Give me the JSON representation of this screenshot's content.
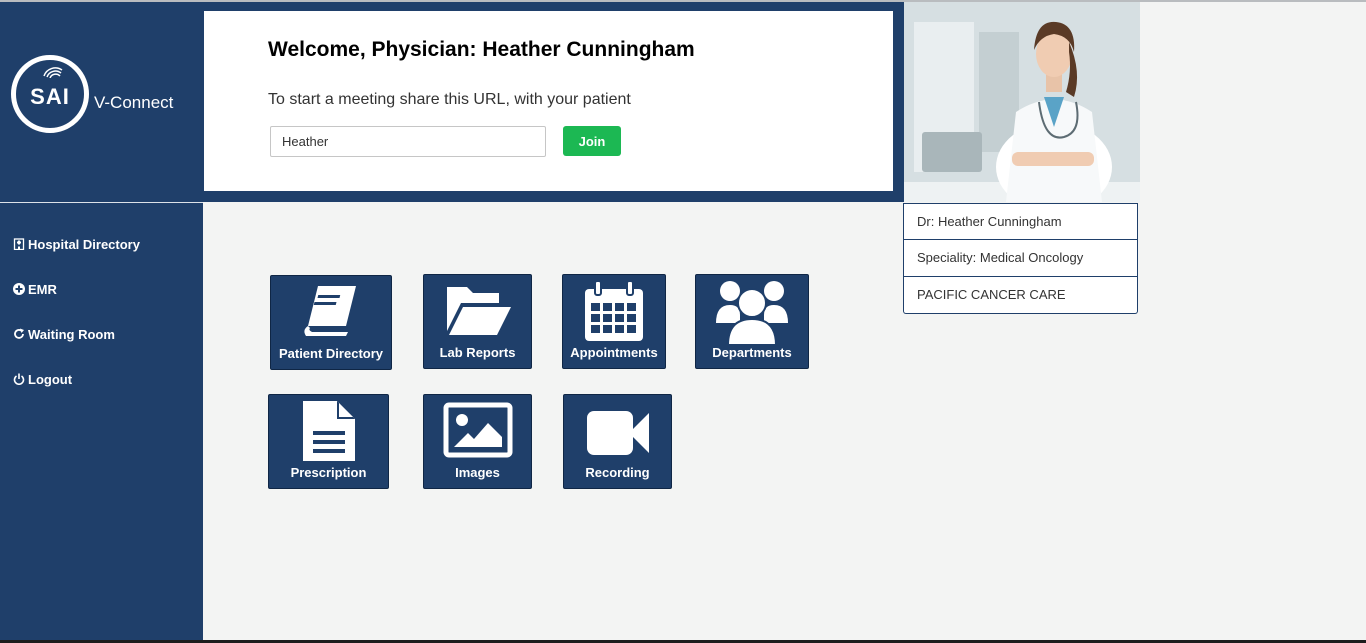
{
  "app": {
    "brand_name": "V-Connect",
    "logo_text": "SAI"
  },
  "sidebar": {
    "items": [
      {
        "label": "Hospital Directory",
        "icon": "hospital-icon"
      },
      {
        "label": "EMR",
        "icon": "plus-circle-icon"
      },
      {
        "label": "Waiting Room",
        "icon": "refresh-icon"
      },
      {
        "label": "Logout",
        "icon": "power-icon"
      }
    ]
  },
  "welcome": {
    "title": "Welcome, Physician: Heather Cunningham",
    "subtitle": "To start a meeting share this URL, with your patient",
    "url_value": "Heather",
    "join_label": "Join"
  },
  "profile": {
    "name": "Dr: Heather Cunningham",
    "speciality": "Speciality: Medical Oncology",
    "organization": "PACIFIC CANCER CARE"
  },
  "tiles": [
    {
      "label": "Patient Directory",
      "icon": "book-icon"
    },
    {
      "label": "Lab Reports",
      "icon": "folder-open-icon"
    },
    {
      "label": "Appointments",
      "icon": "calendar-icon"
    },
    {
      "label": "Departments",
      "icon": "users-icon"
    },
    {
      "label": "Prescription",
      "icon": "document-icon"
    },
    {
      "label": "Images",
      "icon": "image-icon"
    },
    {
      "label": "Recording",
      "icon": "video-camera-icon"
    }
  ],
  "colors": {
    "navy": "#1f3f6a",
    "join_green": "#1cb853",
    "background": "#f3f4f3"
  }
}
